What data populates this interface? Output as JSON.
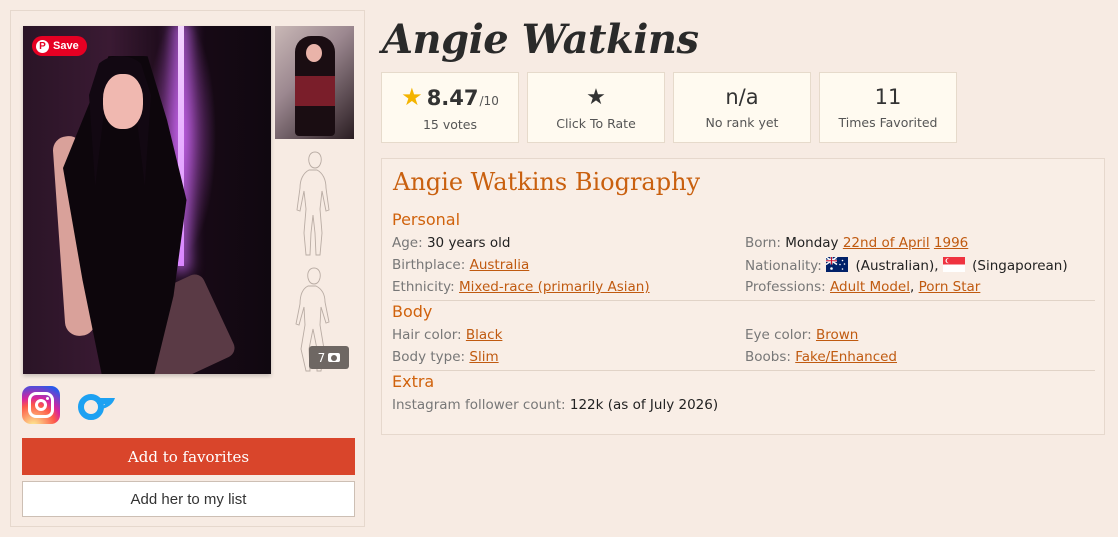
{
  "gallery": {
    "save_label": "Save",
    "photo_count": "7"
  },
  "actions": {
    "favorites_label": "Add to favorites",
    "list_label": "Add her to my list"
  },
  "profile": {
    "name": "Angie Watkins"
  },
  "stats": {
    "rating": "8.47",
    "rating_denominator": "/10",
    "votes": "15 votes",
    "rate_label": "Click To Rate",
    "rank": "n/a",
    "rank_label": "No rank yet",
    "favorited_count": "11",
    "favorited_label": "Times Favorited"
  },
  "bio": {
    "title": "Angie Watkins Biography",
    "personal_heading": "Personal",
    "age_label": "Age:",
    "age_value": "30 years old",
    "born_label": "Born:",
    "born_day": "Monday",
    "born_date": "22nd of April",
    "born_year": "1996",
    "birthplace_label": "Birthplace:",
    "birthplace_value": "Australia",
    "nationality_label": "Nationality:",
    "nationality_1": "(Australian),",
    "nationality_2": "(Singaporean)",
    "ethnicity_label": "Ethnicity:",
    "ethnicity_value": "Mixed-race (primarily Asian)",
    "professions_label": "Professions:",
    "profession_1": "Adult Model",
    "profession_sep": ",",
    "profession_2": "Porn Star",
    "body_heading": "Body",
    "hair_label": "Hair color:",
    "hair_value": "Black",
    "eye_label": "Eye color:",
    "eye_value": "Brown",
    "bodytype_label": "Body type:",
    "bodytype_value": "Slim",
    "boobs_label": "Boobs:",
    "boobs_value": "Fake/Enhanced",
    "extra_heading": "Extra",
    "instagram_label": "Instagram follower count:",
    "instagram_value": "122k (as of July 2026)"
  },
  "colors": {
    "accent": "#c9600f",
    "button_red": "#d9452b",
    "background": "#f7ebe3"
  },
  "icons": [
    "instagram-icon",
    "onlyfans-icon",
    "camera-icon",
    "star-icon",
    "pinterest-icon"
  ]
}
